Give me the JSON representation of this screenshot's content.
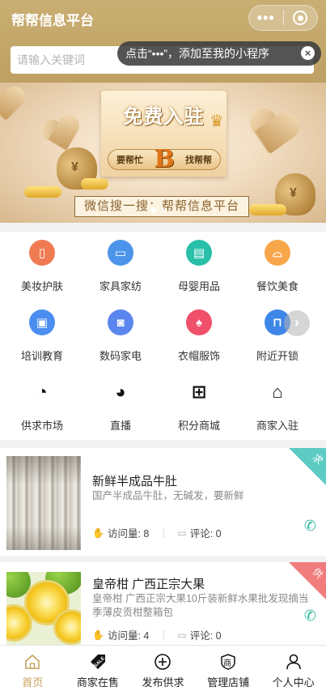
{
  "header": {
    "title": "帮帮信息平台",
    "more_glyph": "•••"
  },
  "search": {
    "placeholder": "请输入关键词"
  },
  "tip": {
    "text": "点击“•••”，添加至我的小程序",
    "close_glyph": "×"
  },
  "banner": {
    "headline": "免费入驻",
    "left_slogan": "要帮忙",
    "logo_letter": "B",
    "right_slogan": "找帮帮",
    "caption": "微信搜一搜：帮帮信息平台",
    "slide_count": 2,
    "active_slide": 1
  },
  "categories": [
    {
      "label": "美妆护肤",
      "icon": "lipstick-icon",
      "color": "#f07a52",
      "glyph": "▯"
    },
    {
      "label": "家具家纺",
      "icon": "sofa-icon",
      "color": "#4b94ea",
      "glyph": "▭"
    },
    {
      "label": "母婴用品",
      "icon": "baby-bottle-icon",
      "color": "#28c0a8",
      "glyph": "▤"
    },
    {
      "label": "餐饮美食",
      "icon": "dish-cover-icon",
      "color": "#f8a64a",
      "glyph": "⌓"
    },
    {
      "label": "培训教育",
      "icon": "blackboard-icon",
      "color": "#4b8ef0",
      "glyph": "▣"
    },
    {
      "label": "数码家电",
      "icon": "camera-icon",
      "color": "#5c86ef",
      "glyph": "◙"
    },
    {
      "label": "衣帽服饰",
      "icon": "dress-icon",
      "color": "#f0506a",
      "glyph": "♠"
    },
    {
      "label": "附近开锁",
      "icon": "padlock-icon",
      "color": "#3d86e8",
      "glyph": "⊓"
    },
    {
      "label": "供求市场",
      "icon": "magnifier-icon",
      "color": "",
      "glyph": "◔"
    },
    {
      "label": "直播",
      "icon": "chat-bubble-icon",
      "color": "",
      "glyph": "◕"
    },
    {
      "label": "积分商城",
      "icon": "gift-icon",
      "color": "",
      "glyph": "⊞"
    },
    {
      "label": "商家入驻",
      "icon": "shop-house-icon",
      "color": "",
      "glyph": "⌂"
    }
  ],
  "listings": [
    {
      "title": "新鲜半成品牛肚",
      "description": "国产半成品牛肚，无碱发，要新鲜",
      "views_label": "访问量: 8",
      "comments_label": "评论: 0",
      "corner_text": "求",
      "corner_color": "#5ccbc3"
    },
    {
      "title": "皇帝柑 广西正宗大果",
      "description": "皇帝柑 广西正宗大果10斤装新鲜水果批发现摘当季薄皮贡柑整箱包",
      "views_label": "访问量: 4",
      "comments_label": "评论: 0",
      "corner_text": "供",
      "corner_color": "#f07c7c"
    }
  ],
  "tabbar": [
    {
      "label": "首页",
      "icon": "home-icon",
      "active": true
    },
    {
      "label": "商家在售",
      "icon": "sale-tag-icon",
      "active": false
    },
    {
      "label": "发布供求",
      "icon": "plus-circle-icon",
      "active": false
    },
    {
      "label": "管理店铺",
      "icon": "shop-badge-icon",
      "active": false,
      "icon_text": "商"
    },
    {
      "label": "个人中心",
      "icon": "person-icon",
      "active": false
    }
  ],
  "colors": {
    "brand_gold": "#c9ae72",
    "tab_active": "#c7a25e",
    "phone_green": "#2fb8a0"
  }
}
